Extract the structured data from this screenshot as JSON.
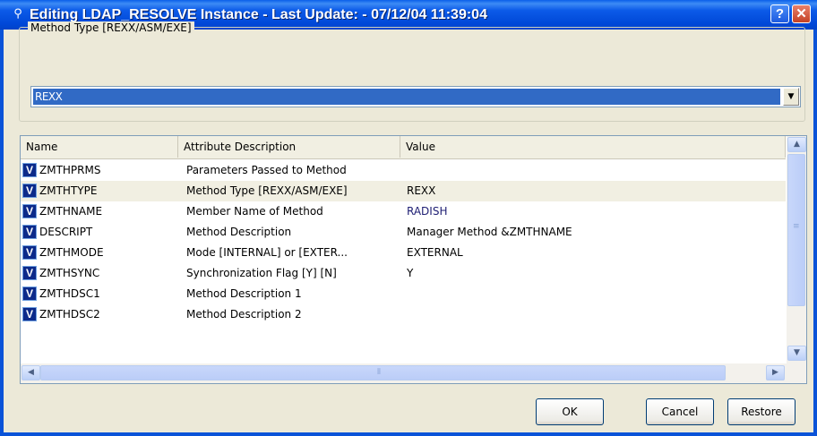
{
  "window": {
    "title": "Editing LDAP_RESOLVE Instance - Last Update: - 07/12/04 11:39:04",
    "help_label": "?",
    "close_label": "✕"
  },
  "method_group": {
    "label": "Method Type [REXX/ASM/EXE]",
    "selected_value": "REXX",
    "dropdown_glyph": "▼"
  },
  "table": {
    "columns": [
      "Name",
      "Attribute Description",
      "Value"
    ],
    "rows": [
      {
        "icon": "V",
        "name": "ZMTHPRMS",
        "desc": "Parameters Passed to Method",
        "value": ""
      },
      {
        "icon": "V",
        "name": "ZMTHTYPE",
        "desc": "Method Type [REXX/ASM/EXE]",
        "value": "REXX"
      },
      {
        "icon": "V",
        "name": "ZMTHNAME",
        "desc": "Member Name of Method",
        "value": "RADISH"
      },
      {
        "icon": "V",
        "name": "DESCRIPT",
        "desc": "Method Description",
        "value": "Manager Method &ZMTHNAME"
      },
      {
        "icon": "V",
        "name": "ZMTHMODE",
        "desc": "Mode [INTERNAL] or [EXTER...",
        "value": "EXTERNAL"
      },
      {
        "icon": "V",
        "name": "ZMTHSYNC",
        "desc": "Synchronization Flag [Y] [N]",
        "value": "Y"
      },
      {
        "icon": "V",
        "name": "ZMTHDSC1",
        "desc": "Method Description 1",
        "value": ""
      },
      {
        "icon": "V",
        "name": "ZMTHDSC2",
        "desc": "Method Description 2",
        "value": ""
      }
    ]
  },
  "scrollbars": {
    "up": "▲",
    "down": "▼",
    "left": "◀",
    "right": "▶",
    "grip_v": "≡",
    "grip_h": "⦀"
  },
  "buttons": {
    "ok": "OK",
    "cancel": "Cancel",
    "restore": "Restore"
  },
  "colors": {
    "titlebar": "#0A53D8",
    "selection": "#316AC5",
    "close_button": "#C44125"
  }
}
